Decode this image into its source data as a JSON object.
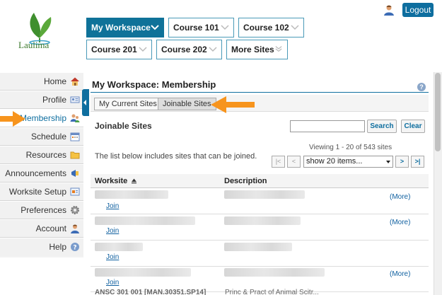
{
  "header": {
    "logo_text": "Laulima",
    "logout_label": "Logout"
  },
  "site_tabs": [
    {
      "label": "My Workspace",
      "active": true
    },
    {
      "label": "Course 101"
    },
    {
      "label": "Course 102"
    },
    {
      "label": "Course 201"
    },
    {
      "label": "Course 202"
    },
    {
      "label": "More Sites"
    }
  ],
  "left_nav": {
    "items": [
      {
        "label": "Home",
        "icon": "home-icon"
      },
      {
        "label": "Profile",
        "icon": "profile-card-icon"
      },
      {
        "label": "Membership",
        "icon": "membership-icon",
        "active": true
      },
      {
        "label": "Schedule",
        "icon": "calendar-icon"
      },
      {
        "label": "Resources",
        "icon": "folder-icon"
      },
      {
        "label": "Announcements",
        "icon": "megaphone-icon"
      },
      {
        "label": "Worksite Setup",
        "icon": "worksite-icon"
      },
      {
        "label": "Preferences",
        "icon": "gear-icon"
      },
      {
        "label": "Account",
        "icon": "user-icon"
      },
      {
        "label": "Help",
        "icon": "help-icon"
      }
    ]
  },
  "main": {
    "title": "My Workspace: Membership",
    "subtabs": [
      {
        "label": "My Current Sites"
      },
      {
        "label": "Joinable Sites",
        "active": true
      }
    ],
    "section_title": "Joinable Sites",
    "search_button": "Search",
    "clear_button": "Clear",
    "viewing_text": "Viewing 1 - 20 of 543 sites",
    "info_text": "The list below includes sites that can be joined.",
    "pager": {
      "first": "|<",
      "prev": "<",
      "next": ">",
      "last": ">|",
      "page_size": "show 20 items..."
    },
    "table": {
      "col_worksite": "Worksite",
      "col_description": "Description",
      "rows": [
        {
          "join": "Join",
          "more": "(More)"
        },
        {
          "join": "Join",
          "more": "(More)"
        },
        {
          "join": "Join",
          "more": ""
        },
        {
          "join": "Join",
          "more": "(More)"
        }
      ],
      "partial_row": {
        "site": "ANSC 301 001 [MAN.30351.SP14]",
        "description": "Princ & Pract of Animal Scitr..."
      }
    }
  },
  "colors": {
    "accent": "#0e6e9f",
    "arrow": "#f7941d"
  }
}
